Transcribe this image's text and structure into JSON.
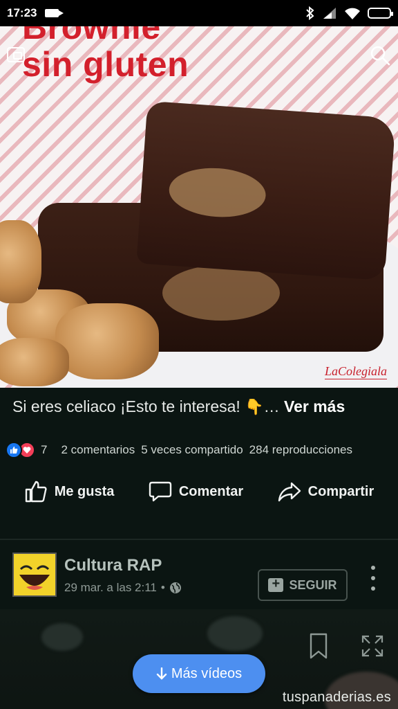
{
  "status_bar": {
    "time": "17:23"
  },
  "video": {
    "title_line1": "Brownie",
    "title_line2": "sin gluten",
    "watermark": "LaColegiala"
  },
  "post": {
    "caption": "Si eres celiaco ¡Esto te interesa!",
    "caption_ellipsis": "…",
    "see_more": "Ver más",
    "reaction_count": "7",
    "comments": "2 comentarios",
    "shares": "5 veces compartido",
    "views": "284 reproducciones"
  },
  "actions": {
    "like": "Me gusta",
    "comment": "Comentar",
    "share": "Compartir"
  },
  "next_post": {
    "author": "Cultura RAP",
    "date": "29 mar. a las 2:11",
    "separator": "•",
    "follow": "SEGUIR"
  },
  "more_videos": "Más vídeos",
  "site_mark": "tuspanaderias.es",
  "colors": {
    "accent": "#4d8ff0",
    "like_blue": "#1877f2",
    "love_red": "#f33e58",
    "title_red": "#d3202c",
    "background": "#0b1512"
  }
}
